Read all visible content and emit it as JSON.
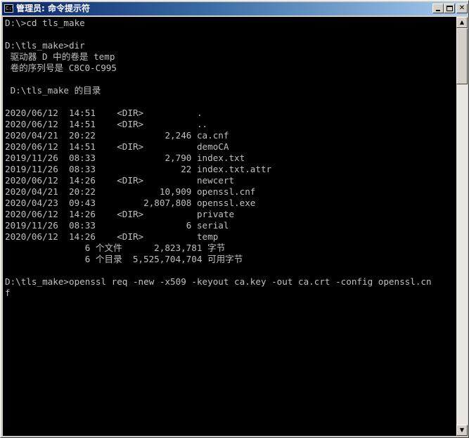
{
  "window": {
    "title": "管理员: 命令提示符",
    "icon_label": "C:\\",
    "close_glyph": "✕"
  },
  "console": {
    "lines": [
      "D:\\>cd tls_make",
      "",
      "D:\\tls_make>dir",
      " 驱动器 D 中的卷是 temp",
      " 卷的序列号是 C8C0-C995",
      "",
      " D:\\tls_make 的目录",
      "",
      "2020/06/12  14:51    <DIR>          .",
      "2020/06/12  14:51    <DIR>          ..",
      "2020/04/21  20:22             2,246 ca.cnf",
      "2020/06/12  14:51    <DIR>          demoCA",
      "2019/11/26  08:33             2,790 index.txt",
      "2019/11/26  08:33                22 index.txt.attr",
      "2020/06/12  14:26    <DIR>          newcert",
      "2020/04/21  20:22            10,909 openssl.cnf",
      "2020/04/23  09:43         2,807,808 openssl.exe",
      "2020/06/12  14:26    <DIR>          private",
      "2019/11/26  08:33                 6 serial",
      "2020/06/12  14:26    <DIR>          temp",
      "               6 个文件      2,823,781 字节",
      "               6 个目录  5,525,704,704 可用字节",
      "",
      "D:\\tls_make>openssl req -new -x509 -keyout ca.key -out ca.crt -config openssl.cn",
      "f"
    ]
  },
  "scrollbar": {
    "up_glyph": "▲",
    "down_glyph": "▼"
  }
}
